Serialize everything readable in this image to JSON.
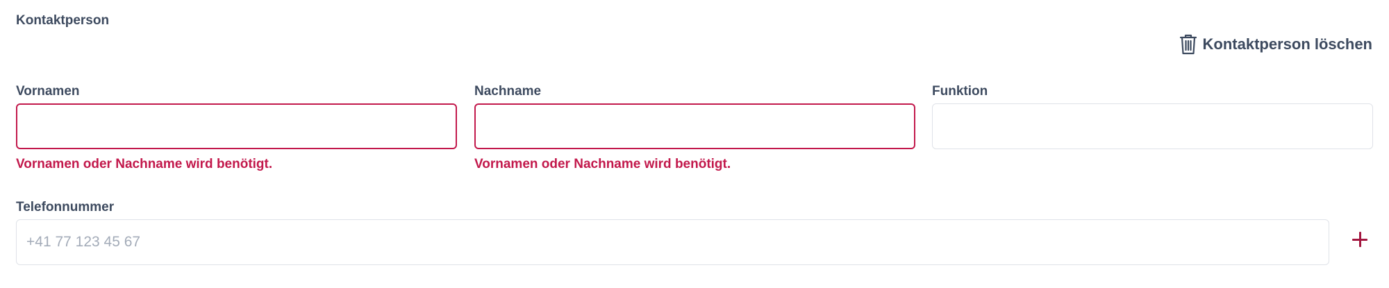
{
  "section": {
    "title": "Kontaktperson",
    "delete_label": "Kontaktperson löschen",
    "delete_icon": "trash-icon"
  },
  "fields": {
    "first_name": {
      "label": "Vornamen",
      "value": "",
      "error": "Vornamen oder Nachname wird benötigt."
    },
    "last_name": {
      "label": "Nachname",
      "value": "",
      "error": "Vornamen oder Nachname wird benötigt."
    },
    "function": {
      "label": "Funktion",
      "value": ""
    },
    "phone": {
      "label": "Telefonnummer",
      "placeholder": "+41 77 123 45 67",
      "value": ""
    }
  },
  "add_phone_icon": "plus-icon",
  "colors": {
    "text": "#3d4a5f",
    "error": "#c2184b",
    "accent": "#a3163f",
    "border": "#dfe2e8",
    "placeholder": "#a3abb8"
  }
}
